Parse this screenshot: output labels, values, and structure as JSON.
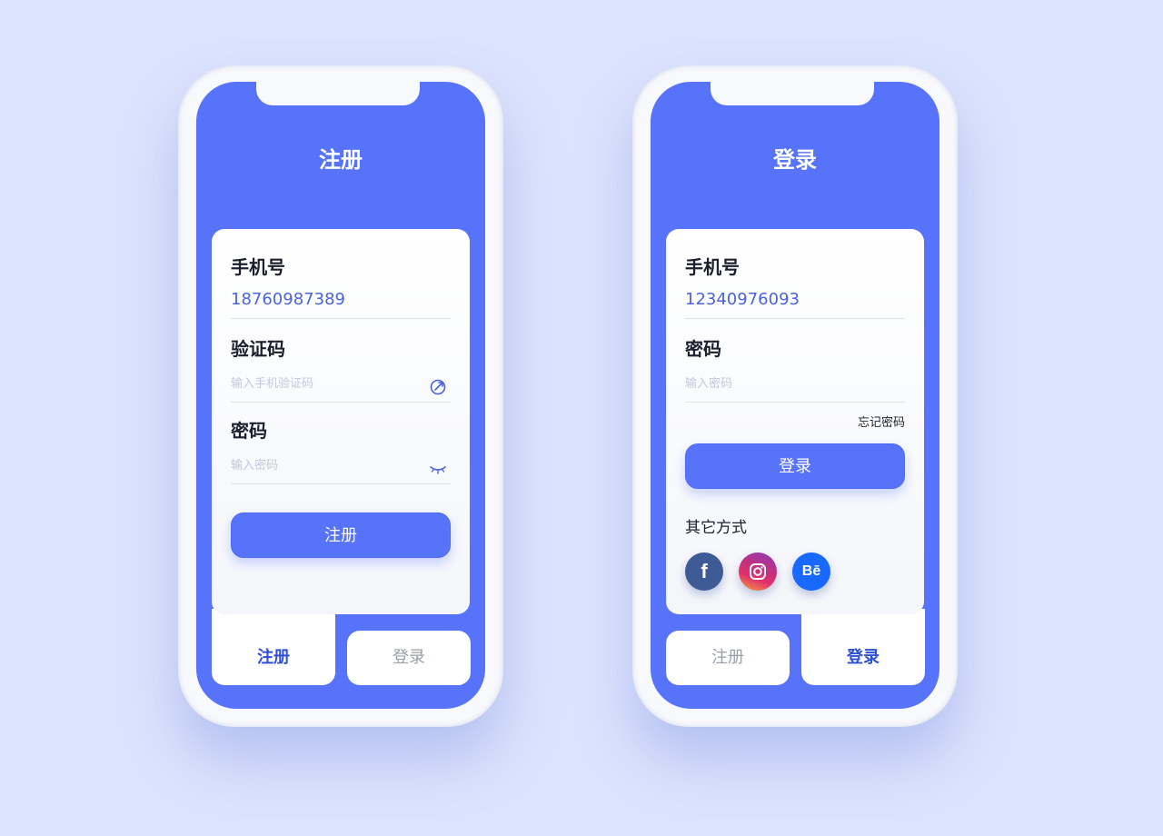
{
  "register_screen": {
    "title": "注册",
    "phone_label": "手机号",
    "phone_value": "18760987389",
    "code_label": "验证码",
    "code_placeholder": "输入手机验证码",
    "password_label": "密码",
    "password_placeholder": "输入密码",
    "submit_label": "注册",
    "tabs": [
      {
        "label": "注册",
        "active": true
      },
      {
        "label": "登录",
        "active": false
      }
    ]
  },
  "login_screen": {
    "title": "登录",
    "phone_label": "手机号",
    "phone_value": "12340976093",
    "password_label": "密码",
    "password_placeholder": "输入密码",
    "forgot_label": "忘记密码",
    "submit_label": "登录",
    "other_label": "其它方式",
    "social": [
      {
        "name": "facebook",
        "glyph": "f",
        "color": "#3f5b96"
      },
      {
        "name": "instagram",
        "color": "#c7307a"
      },
      {
        "name": "behance",
        "glyph": "Bē",
        "color": "#1769ff"
      }
    ],
    "tabs": [
      {
        "label": "注册",
        "active": false
      },
      {
        "label": "登录",
        "active": true
      }
    ]
  },
  "colors": {
    "background": "#dce3fd",
    "accent": "#5673f9",
    "value_text": "#4a62de",
    "active_tab": "#2f4fd6"
  }
}
